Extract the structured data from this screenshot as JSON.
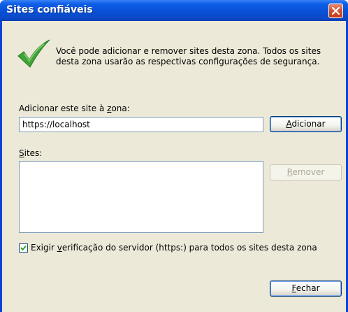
{
  "window": {
    "title": "Sites confiáveis"
  },
  "info": {
    "text": "Você pode adicionar e remover sites desta zona. Todos os sites desta zona usarão as respectivas configurações de segurança."
  },
  "add_zone": {
    "label_pre": "Adicionar este site à ",
    "label_key": "z",
    "label_post": "ona:",
    "value": "https://localhost",
    "button_key": "A",
    "button_rest": "dicionar"
  },
  "sites": {
    "label_key": "S",
    "label_rest": "ites:",
    "items": [],
    "remove_key": "R",
    "remove_rest": "emover"
  },
  "verify": {
    "checked": true,
    "label_pre": "Exigir ",
    "label_key": "v",
    "label_post": "erificação do servidor (https:) para todos os sites desta zona"
  },
  "close": {
    "key": "F",
    "rest": "echar"
  },
  "colors": {
    "titlebar": "#0a50d6",
    "client": "#ece9d8",
    "check_green": "#3fa33a"
  }
}
